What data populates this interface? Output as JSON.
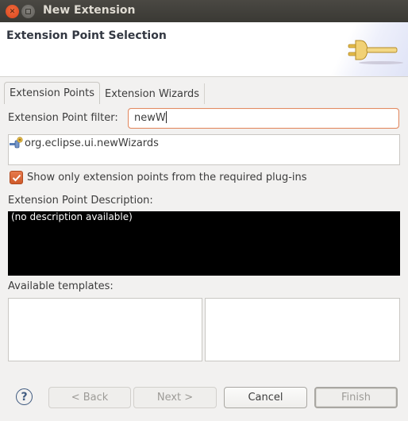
{
  "window": {
    "title": "New Extension",
    "close_icon": "close-icon",
    "maximize_icon": "maximize-icon"
  },
  "header": {
    "title": "Extension Point Selection",
    "banner_icon": "plug-icon"
  },
  "tabs": [
    {
      "label": "Extension Points",
      "active": true
    },
    {
      "label": "Extension Wizards",
      "active": false
    }
  ],
  "filter": {
    "label": "Extension Point filter:",
    "value": "newW"
  },
  "extension_points": [
    {
      "label": "org.eclipse.ui.newWizards",
      "icon": "extension-point-icon"
    }
  ],
  "checkbox": {
    "label": "Show only extension points from the required plug-ins",
    "checked": true
  },
  "description": {
    "label": "Extension Point Description:",
    "text": "(no description available)"
  },
  "templates": {
    "label": "Available templates:"
  },
  "footer": {
    "help_icon": "help-icon",
    "back_label": "< Back",
    "next_label": "Next >",
    "cancel_label": "Cancel",
    "finish_label": "Finish"
  }
}
